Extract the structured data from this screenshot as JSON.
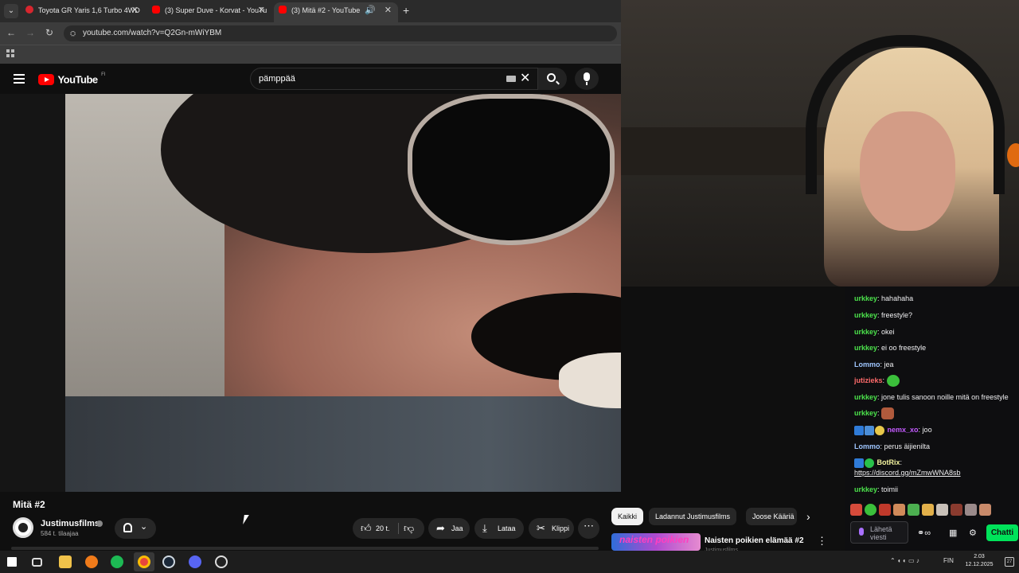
{
  "browser": {
    "tabs": [
      {
        "title": "Toyota GR Yaris 1,6 Turbo 4WD",
        "favicon_color": "#d7262e"
      },
      {
        "title": "(3) Super Duve - Korvat - YouTu",
        "favicon_color": "#ff0000"
      },
      {
        "title": "(3) Mitä #2 - YouTube",
        "favicon_color": "#ff0000",
        "active": true
      }
    ],
    "url": "youtube.com/watch?v=Q2Gn-mWiYBM"
  },
  "youtube": {
    "logo_text": "YouTube",
    "region": "FI",
    "search_value": "pämppää",
    "video": {
      "title": "Mitä #2",
      "channel": "Justimusfilms",
      "subscribers": "584 t. tilaajaa",
      "likes": "20 t.",
      "share_label": "Jaa",
      "download_label": "Lataa",
      "clip_label": "Klippi"
    },
    "chips": [
      "Kaikki",
      "Ladannut Justimusfilms",
      "Joose Kääriä"
    ],
    "recommendation": {
      "title": "Naisten poikien elämää #2",
      "channel": "Justimusfilms",
      "thumb_text": "naisten poikien"
    }
  },
  "chat": {
    "messages": [
      {
        "user": "urkkey",
        "color": "#4ce34c",
        "text": "hahahaha"
      },
      {
        "user": "urkkey",
        "color": "#4ce34c",
        "text": "freestyle?"
      },
      {
        "user": "urkkey",
        "color": "#4ce34c",
        "text": "okei"
      },
      {
        "user": "urkkey",
        "color": "#4ce34c",
        "text": "ei oo freestyle"
      },
      {
        "user": "Lommo",
        "color": "#9fc6ff",
        "text": "jea"
      },
      {
        "user": "jutizieks",
        "color": "#ff6b6b",
        "text": "",
        "emote_color": "#3bbf3b"
      },
      {
        "user": "urkkey",
        "color": "#4ce34c",
        "text": "jone tulis sanoon noille mitä on freestyle"
      },
      {
        "user": "urkkey",
        "color": "#4ce34c",
        "text": "",
        "emote_color": "#b05a3c"
      },
      {
        "user": "nemx_xo",
        "color": "#c45bff",
        "text": "joo"
      },
      {
        "user": "Lommo",
        "color": "#9fc6ff",
        "text": "perus äijienilta"
      },
      {
        "user": "BotRix",
        "color": "#f5f5a0",
        "text": ""
      },
      {
        "user": "",
        "color": "#efeff1",
        "text": "https://discord.gg/mZmwWNA8sb"
      },
      {
        "user": "urkkey",
        "color": "#4ce34c",
        "text": "toimii"
      }
    ],
    "input_placeholder": "Lähetä viesti",
    "send_label": "Chatti"
  },
  "taskbar": {
    "lang": "FIN",
    "time": "2.03",
    "date": "12.12.2025",
    "notifications": "27"
  }
}
